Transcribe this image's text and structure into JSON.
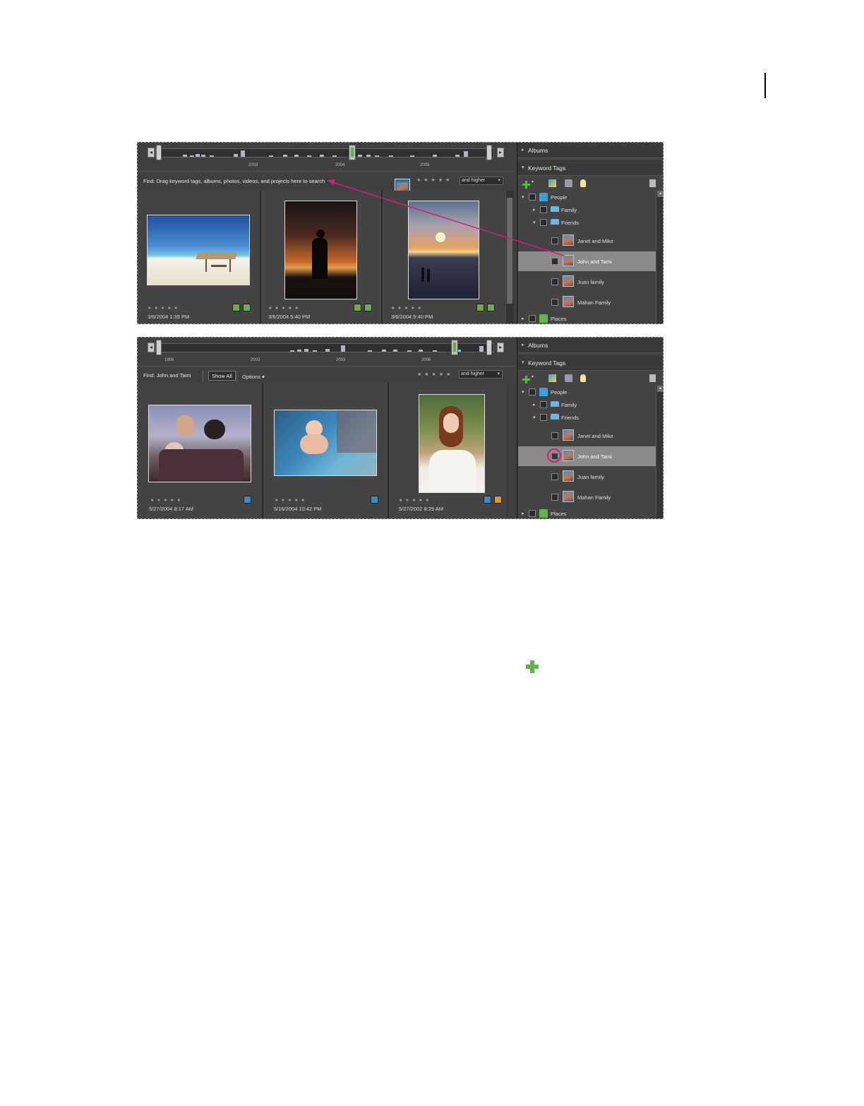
{
  "shot1": {
    "timeline_years": [
      "2003",
      "2004",
      "2005"
    ],
    "find_text": "Find: Drag keyword tags, albums, photos, videos, and projects here to search",
    "rating_filter": "and higher",
    "photos": [
      {
        "date": "3/6/2004 1:39 PM",
        "stars": "★★★★★"
      },
      {
        "date": "3/6/2004 5:40 PM",
        "stars": "★★★★★"
      },
      {
        "date": "3/6/2004 5:40 PM",
        "stars": "★★★★★"
      }
    ],
    "panel": {
      "albums": "Albums",
      "keyword_tags": "Keyword Tags",
      "tags": {
        "people": "People",
        "family": "Family",
        "friends": "Friends",
        "janet": "Janet and Mike",
        "john": "John and Tami",
        "juan": "Juan family",
        "mahan": "Mahan Family",
        "places": "Places"
      }
    }
  },
  "shot2": {
    "timeline_years": [
      "1999",
      "2002",
      "2003",
      "2006"
    ],
    "find_text": "Find: John and Tami",
    "show_all": "Show All",
    "options": "Options",
    "rating_filter": "and higher",
    "photos": [
      {
        "date": "5/27/2004 8:17 AM",
        "stars": "★★★★★"
      },
      {
        "date": "5/16/2004 10:42 PM",
        "stars": "★★★★★"
      },
      {
        "date": "5/27/2002 8:29 AM",
        "stars": "★★★★★"
      }
    ],
    "panel": {
      "albums": "Albums",
      "keyword_tags": "Keyword Tags",
      "tags": {
        "people": "People",
        "family": "Family",
        "friends": "Friends",
        "janet": "Janet and Mike",
        "john": "John and Tami",
        "juan": "Juan family",
        "mahan": "Mahan Family",
        "places": "Places"
      }
    }
  },
  "colors": {
    "accent_green": "#5fb54a",
    "tag_blue": "#3aa0d8",
    "highlight_magenta": "#d0207a",
    "orange_badge": "#f09020"
  },
  "icons": [
    "plus-icon",
    "edit-tag-icon",
    "tag-lock-icon",
    "lightbulb-icon",
    "trash-icon",
    "hand-cursor-icon"
  ]
}
